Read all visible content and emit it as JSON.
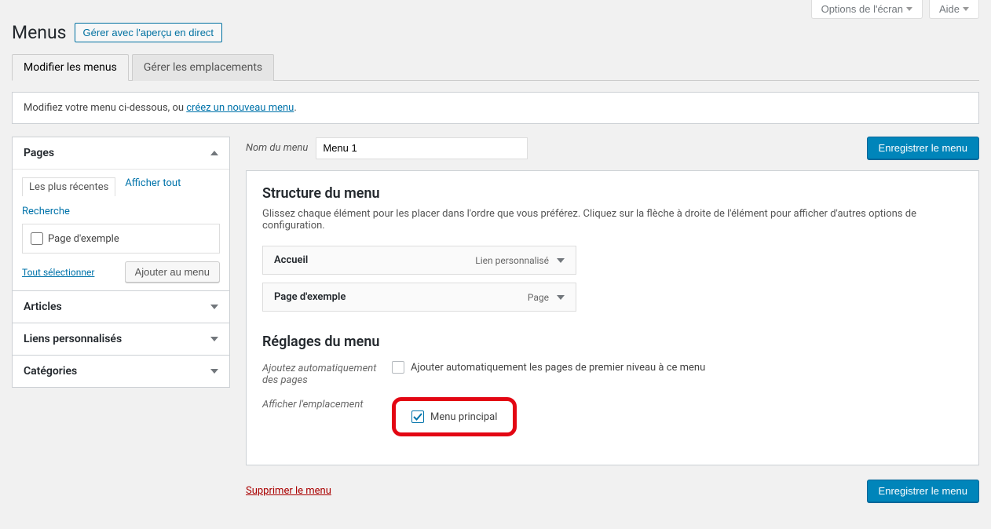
{
  "screen_meta": {
    "screen_options": "Options de l'écran",
    "help": "Aide"
  },
  "header": {
    "title": "Menus",
    "live_preview_button": "Gérer avec l'aperçu en direct"
  },
  "tabs": {
    "edit": "Modifier les menus",
    "locations": "Gérer les emplacements"
  },
  "info": {
    "prefix": "Modifiez votre menu ci-dessous, ou ",
    "link": "créez un nouveau menu",
    "suffix": "."
  },
  "sidebar": {
    "pages": {
      "title": "Pages",
      "tabs": {
        "recent": "Les plus récentes",
        "all": "Afficher tout",
        "search": "Recherche"
      },
      "items": [
        {
          "label": "Page d'exemple",
          "checked": false
        }
      ],
      "select_all": "Tout sélectionner",
      "add_button": "Ajouter au menu"
    },
    "articles": {
      "title": "Articles"
    },
    "custom_links": {
      "title": "Liens personnalisés"
    },
    "categories": {
      "title": "Catégories"
    }
  },
  "menu_edit": {
    "name_label": "Nom du menu",
    "name_value": "Menu 1",
    "save_button": "Enregistrer le menu",
    "structure_heading": "Structure du menu",
    "structure_desc": "Glissez chaque élément pour les placer dans l'ordre que vous préférez. Cliquez sur la flèche à droite de l'élément pour afficher d'autres options de configuration.",
    "items": [
      {
        "title": "Accueil",
        "type": "Lien personnalisé"
      },
      {
        "title": "Page d'exemple",
        "type": "Page"
      }
    ],
    "settings_heading": "Réglages du menu",
    "auto_add_label": "Ajoutez automatiquement des pages",
    "auto_add_checkbox": "Ajouter automatiquement les pages de premier niveau à ce menu",
    "location_label": "Afficher l'emplacement",
    "location_checkbox": "Menu principal",
    "delete_link": "Supprimer le menu"
  }
}
